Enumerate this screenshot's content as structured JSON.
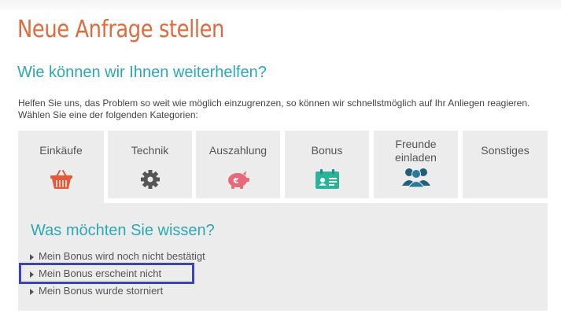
{
  "page": {
    "title": "Neue Anfrage stellen",
    "subtitle": "Wie können wir Ihnen weiterhelfen?",
    "intro": "Helfen Sie uns, das Problem so weit wie möglich einzugrenzen, so können wir schnellstmöglich auf Ihr Anliegen reagieren. Wählen Sie eine der folgenden Kategorien:"
  },
  "categories": [
    {
      "label": "Einkäufe",
      "icon": "shopping-basket-icon",
      "active": true
    },
    {
      "label": "Technik",
      "icon": "gear-icon",
      "active": false
    },
    {
      "label": "Auszahlung",
      "icon": "piggy-bank-icon",
      "active": false
    },
    {
      "label": "Bonus",
      "icon": "bonus-card-icon",
      "active": false
    },
    {
      "label": "Freunde einladen",
      "icon": "friends-icon",
      "active": false
    },
    {
      "label": "Sonstiges",
      "icon": "",
      "active": false
    }
  ],
  "panel": {
    "title": "Was möchten Sie wissen?",
    "questions": [
      "Mein Bonus wird noch nicht bestätigt",
      "Mein Bonus erscheint nicht",
      "Mein Bonus wurde storniert"
    ],
    "highlighted_index": 1
  },
  "colors": {
    "title": "#e06a3b",
    "accent": "#2aa9b4",
    "tab_bg": "#ececec",
    "highlight_border": "#3d45b5",
    "basket": "#e25a3a",
    "gear": "#555555",
    "piggy": "#e86a7a",
    "card": "#29b39a",
    "friends": "#1f5f7a"
  }
}
